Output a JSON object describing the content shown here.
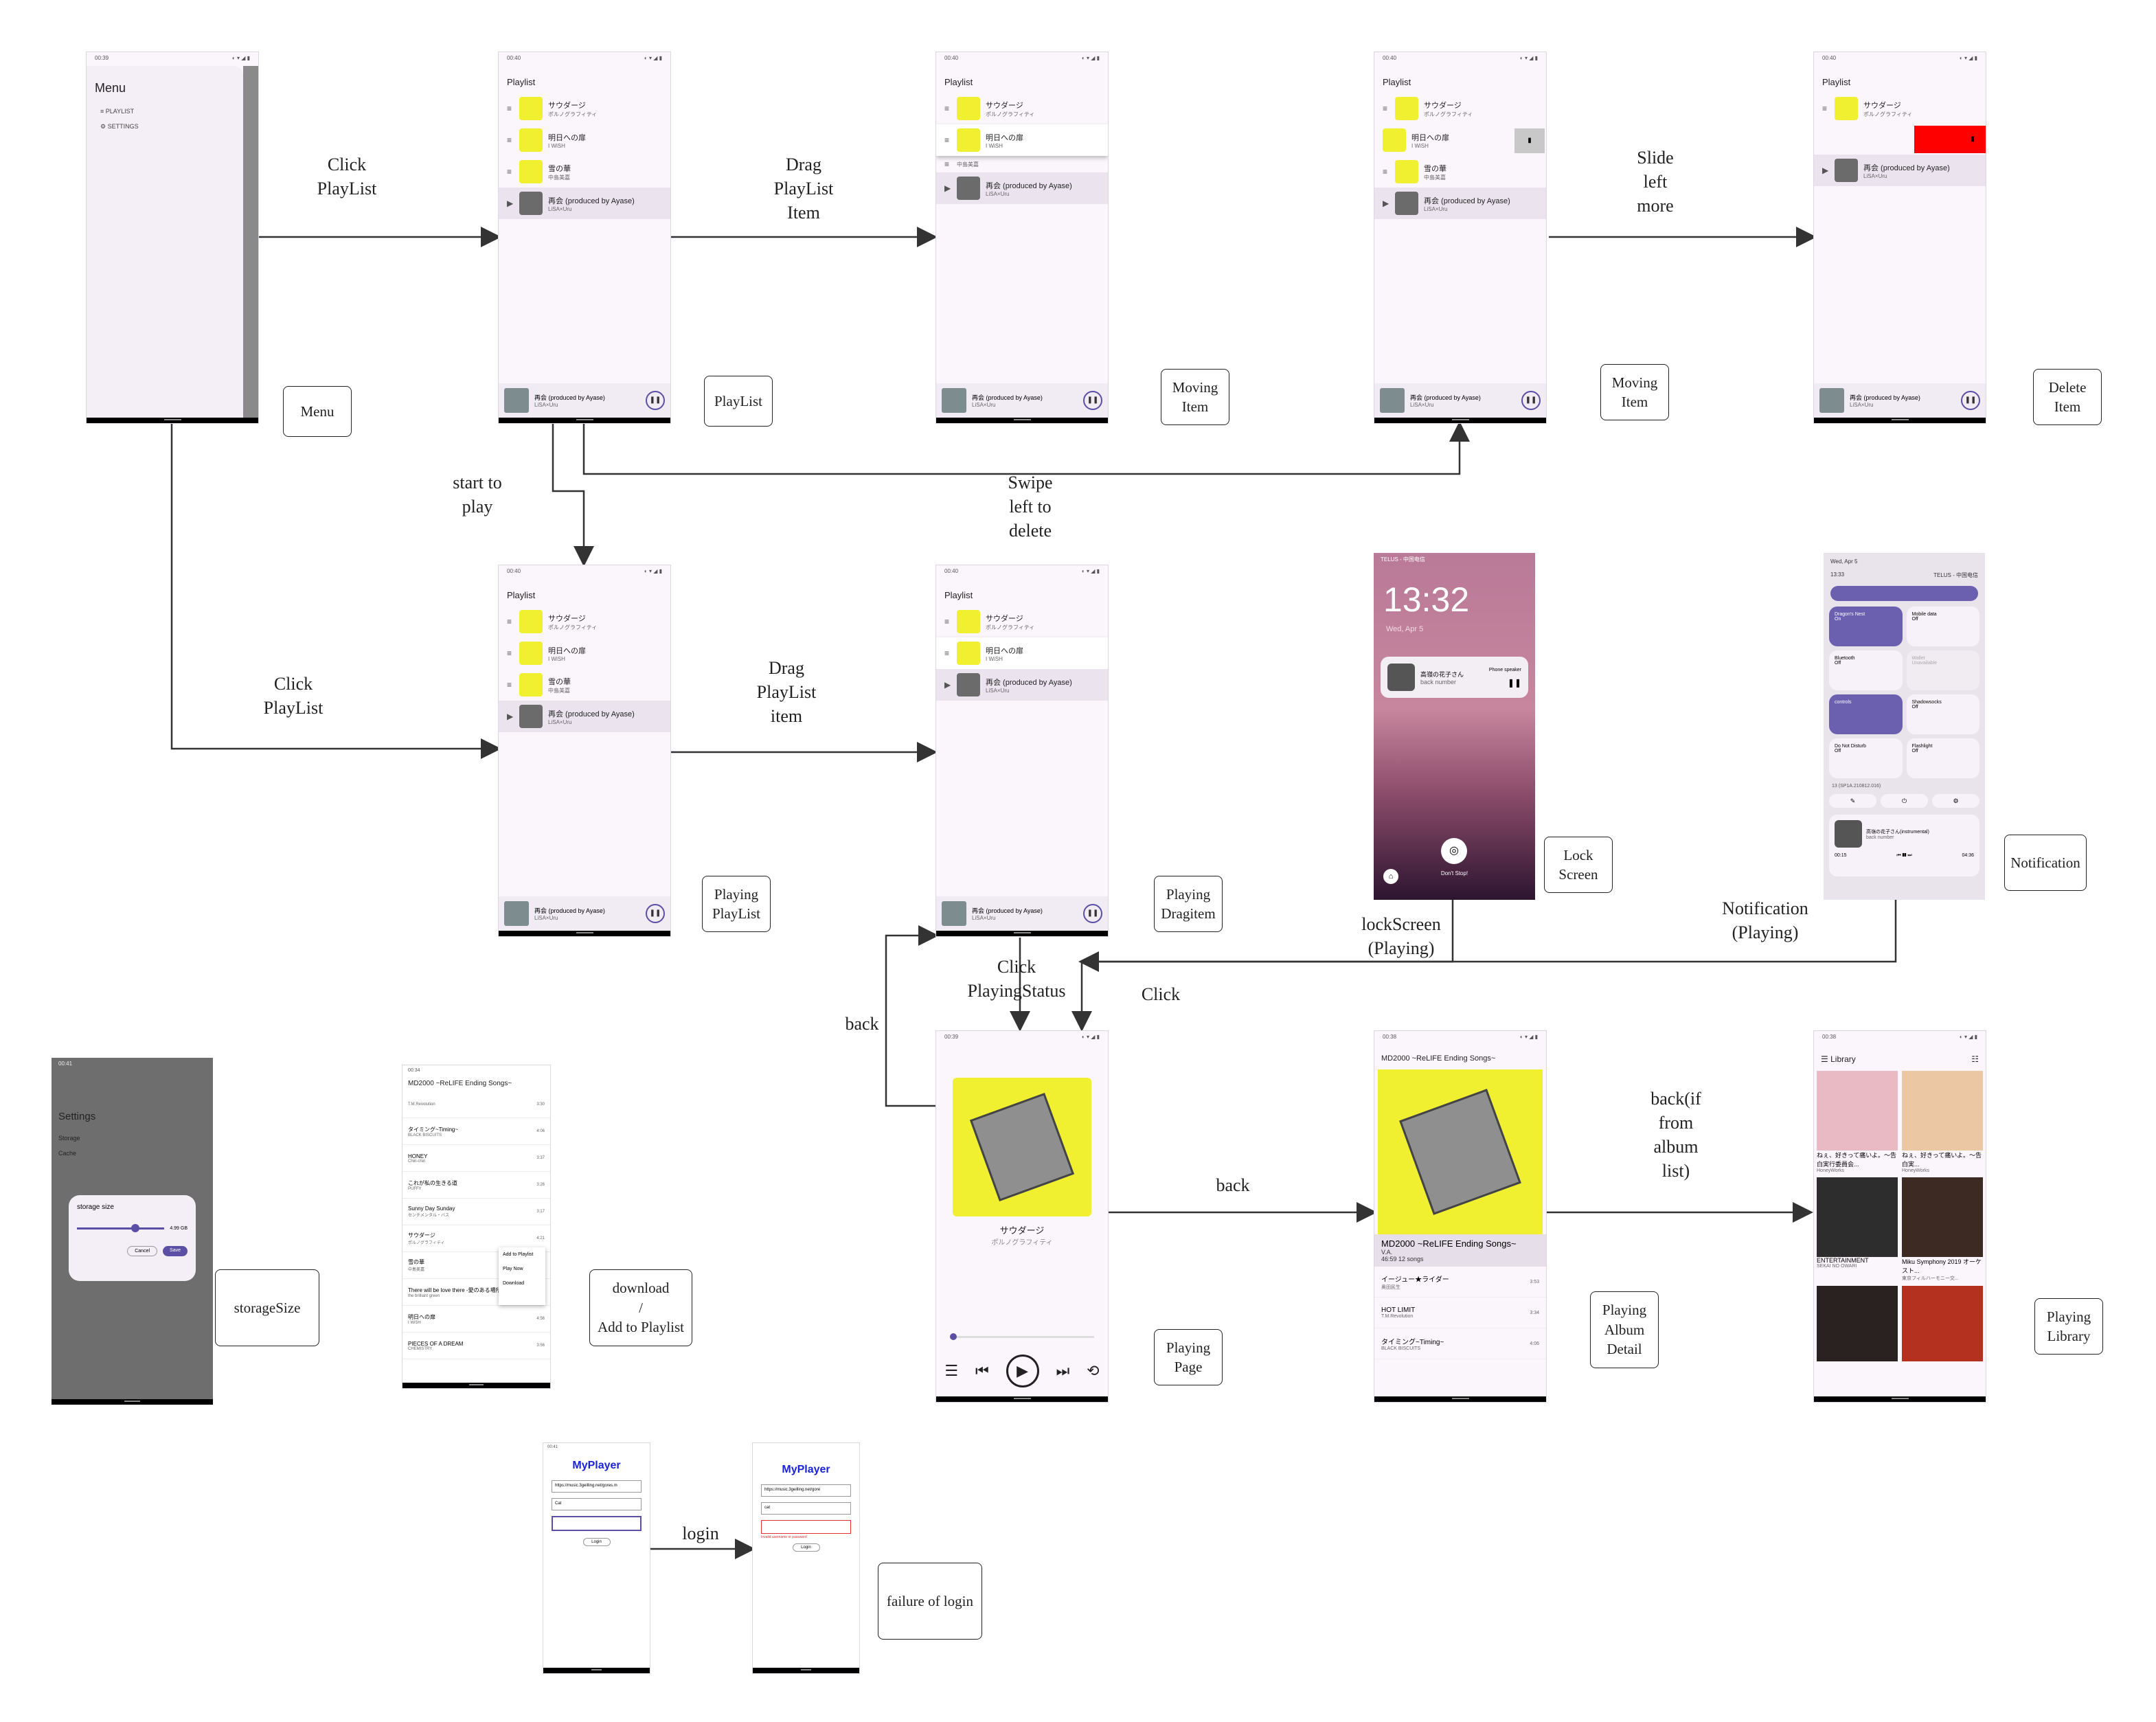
{
  "screens": {
    "menu": {
      "time": "00:39",
      "title": "Menu",
      "items": [
        "PLAYLIST",
        "SETTINGS"
      ]
    },
    "playlist": {
      "time": "00:40",
      "title": "Playlist",
      "songs": [
        {
          "title": "サウダージ",
          "artist": "ポルノグラフィティ"
        },
        {
          "title": "明日への扉",
          "artist": "I WiSH"
        },
        {
          "title": "雪の華",
          "artist": "中島美嘉"
        },
        {
          "title": "再会 (produced by Ayase)",
          "artist": "LiSA×Uru"
        }
      ],
      "now_playing": {
        "title": "再会 (produced by Ayase)",
        "artist": "LiSA×Uru",
        "time": "2:35\n4:02"
      }
    },
    "lock": {
      "time": "13:32",
      "date": "Wed, Apr 5",
      "carrier": "TELUS - 中国电信",
      "song": "高嶺の花子さん",
      "artist": "back number",
      "output": "Phone speaker",
      "dont_stop": "Don't Stop!"
    },
    "notif": {
      "date": "Wed, Apr 5",
      "time": "13:33",
      "carrier": "TELUS - 中国电信",
      "tiles": [
        {
          "name": "Dragon's Nest",
          "state": "On"
        },
        {
          "name": "Mobile data",
          "state": "Off"
        },
        {
          "name": "Bluetooth",
          "state": "Off"
        },
        {
          "name": "Wallet",
          "state": "Unavailable"
        },
        {
          "name": "controls",
          "state": ""
        },
        {
          "name": "Shadowsocks",
          "state": "Off"
        },
        {
          "name": "Do Not Disturb",
          "state": "Off"
        },
        {
          "name": "Flashlight",
          "state": "Off"
        }
      ],
      "build": "13 (SP1A.210812.016)",
      "song": "高嶺の花子さん(instrumental)",
      "artist": "back number",
      "elapsed": "00:15",
      "total": "04:36"
    },
    "settings": {
      "time": "00:41",
      "title": "Settings",
      "items": [
        "Storage",
        "Cache"
      ],
      "dialog_title": "storage size",
      "value": "4.99 GB",
      "cancel": "Cancel",
      "save": "Save"
    },
    "album_list": {
      "time": "00:34",
      "title": "MD2000 ~ReLIFE Ending Songs~",
      "songs": [
        {
          "title": "",
          "artist": "T.M.Revolution",
          "dur": "3:30"
        },
        {
          "title": "タイミング~Timing~",
          "artist": "BLACK BISCUITS",
          "dur": "4:06"
        },
        {
          "title": "HONEY",
          "artist": "Chiri-chiri",
          "dur": "3:37"
        },
        {
          "title": "これが私の生きる道",
          "artist": "PUFFY",
          "dur": "3:26"
        },
        {
          "title": "Sunny Day Sunday",
          "artist": "センチメンタル・バス",
          "dur": "3:17"
        },
        {
          "title": "サウダージ",
          "artist": "ポルノグラフィティ",
          "dur": "4:21"
        },
        {
          "title": "雪の華",
          "artist": "中島美嘉",
          "dur": ""
        },
        {
          "title": "There will be love there -愛のある場所-",
          "artist": "the brilliant green",
          "dur": ""
        },
        {
          "title": "明日への扉",
          "artist": "I WiSH",
          "dur": "4:56"
        },
        {
          "title": "PIECES OF A DREAM",
          "artist": "CHEMISTRY",
          "dur": "3:56"
        }
      ],
      "menu": [
        "Add to Playlist",
        "Play Now",
        "Download"
      ]
    },
    "playing": {
      "time": "00:39",
      "song": "サウダージ",
      "artist": "ポルノグラフィティ"
    },
    "album": {
      "time": "00:38",
      "title": "MD2000 ~ReLIFE Ending Songs~",
      "name": "MD2000 ~ReLIFE Ending Songs~",
      "artist": "V.A.",
      "meta": "46:59 12 songs",
      "songs": [
        {
          "title": "イージュー★ライダー",
          "artist": "奥田民生",
          "dur": "3:53"
        },
        {
          "title": "HOT LIMIT",
          "artist": "T.M.Revolution",
          "dur": "3:34"
        },
        {
          "title": "タイミング~Timing~",
          "artist": "BLACK BISCUITS",
          "dur": "4:06"
        }
      ]
    },
    "library": {
      "time": "00:38",
      "title": "Library",
      "albums": [
        {
          "name": "ねぇ、好きって痛いよ。〜告白実行委員会...",
          "artist": "HoneyWorks"
        },
        {
          "name": "ねぇ、好きって痛いよ。〜告白実...",
          "artist": "HoneyWorks"
        },
        {
          "name": "ENTERTAINMENT",
          "artist": "SEKAI NO OWARI"
        },
        {
          "name": "Miku Symphony 2019 オーケスト...",
          "artist": "東京フィルハーモニー交..."
        }
      ]
    },
    "login1": {
      "time": "00:41",
      "title": "MyPlayer",
      "url": "https://music.3geilling.net/gores.m",
      "user": "Cat",
      "login": "Login"
    },
    "login2": {
      "title": "MyPlayer",
      "url": "https://music.3geilling.net/gore",
      "user": "cat",
      "error": "Invalid username or password",
      "login": "Login"
    }
  },
  "labels": {
    "click_playlist_1": "Click\nPlayList",
    "drag_item_1": "Drag\nPlayList\nItem",
    "slide_left": "Slide\nleft\nmore",
    "swipe_delete": "Swipe\nleft to\ndelete",
    "start_play": "start to\nplay",
    "click_playlist_2": "Click\nPlayList",
    "drag_item_2": "Drag\nPlayList\nitem",
    "lockscreen_playing": "lockScreen\n(Playing)",
    "notification_playing": "Notification\n(Playing)",
    "click_status": "Click\nPlayingStatus",
    "click": "Click",
    "back1": "back",
    "back2": "back",
    "back_album": "back(if\nfrom\nalbum\nlist)",
    "login": "login"
  },
  "boxes": {
    "menu": "Menu",
    "playlist": "PlayList",
    "moving1": "Moving\nItem",
    "moving2": "Moving\nItem",
    "delete": "Delete\nItem",
    "playing_playlist": "Playing\nPlayList",
    "playing_drag": "Playing\nDragitem",
    "lock": "Lock\nScreen",
    "notification": "Notification",
    "storage": "storageSize",
    "download": "download\n/\nAdd to Playlist",
    "playing_page": "Playing\nPage",
    "album_detail": "Playing\nAlbum\nDetail",
    "library": "Playing\nLibrary",
    "failure": "failure of login"
  }
}
